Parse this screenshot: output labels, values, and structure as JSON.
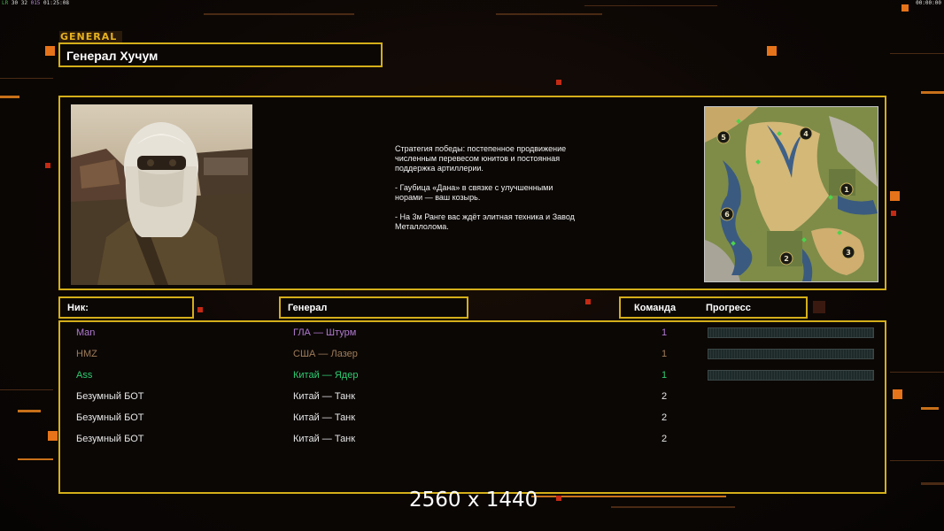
{
  "status_bar": {
    "left_stats": [
      "LR",
      "30",
      "32",
      "015",
      "01:25:08"
    ],
    "right_clock": "00:00:00"
  },
  "header": {
    "tag": "GENERAL",
    "general_name": "Генерал Хучум"
  },
  "info": {
    "strategy_text": "Стратегия победы: постепенное продвижение численным перевесом юнитов и постоянная поддержка артиллерии.\n\n- Гаубица «Дана» в связке с улучшенными норами — ваш козырь.\n\n- На 3м Ранге вас ждёт элитная техника и Завод Металлолома.",
    "map_markers": [
      "5",
      "4",
      "1",
      "6",
      "2",
      "3"
    ]
  },
  "table": {
    "headers": {
      "nick": "Ник:",
      "general": "Генерал",
      "team": "Команда",
      "progress": "Прогресс"
    },
    "rows": [
      {
        "name": "Man",
        "general": "ГЛА — Штурм",
        "team": "1",
        "color": "#b07ad0",
        "progress_bar": true
      },
      {
        "name": "HMZ",
        "general": "США — Лазер",
        "team": "1",
        "color": "#a07d5a",
        "progress_bar": true
      },
      {
        "name": "Ass",
        "general": "Китай — Ядер",
        "team": "1",
        "color": "#2ecc71",
        "progress_bar": true
      },
      {
        "name": "Безумный БОТ",
        "general": "Китай — Танк",
        "team": "2",
        "color": "#e6e6e6",
        "progress_bar": false
      },
      {
        "name": "Безумный БОТ",
        "general": "Китай — Танк",
        "team": "2",
        "color": "#e6e6e6",
        "progress_bar": false
      },
      {
        "name": "Безумный БОТ",
        "general": "Китай — Танк",
        "team": "2",
        "color": "#e6e6e6",
        "progress_bar": false
      }
    ]
  },
  "footer": {
    "resolution": "2560 x 1440"
  },
  "colors": {
    "frame": "#d4ae1a",
    "accent_orange": "#e6731a",
    "background": "#0a0604"
  }
}
